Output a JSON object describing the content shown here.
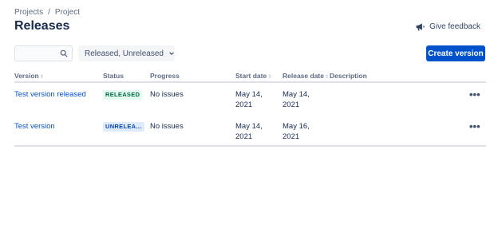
{
  "breadcrumb": [
    {
      "label": "Projects"
    },
    {
      "label": "/"
    },
    {
      "label": "Project"
    }
  ],
  "title": "Releases",
  "feedback": {
    "label": "Give feedback",
    "icon": "megaphone-icon"
  },
  "search": {
    "value": "",
    "placeholder": "",
    "icon": "search-icon"
  },
  "filter": {
    "label": "Released, Unreleased",
    "icon": "chevron-down-icon"
  },
  "create_button": {
    "label": "Create version"
  },
  "columns": [
    "Version",
    "Status",
    "Progress",
    "Start date",
    "Release date",
    "Description"
  ],
  "rows": [
    {
      "version": "Test version released",
      "status": "RELEASED",
      "progress": "No issues",
      "start_date": [
        "May 14,",
        "2021"
      ],
      "release_date": [
        "May 14,",
        "2021"
      ],
      "description": "",
      "more": "•••"
    },
    {
      "version": "Test version",
      "status": "UNRELEA...",
      "progress": "No issues",
      "start_date": [
        "May 14,",
        "2021"
      ],
      "release_date": [
        "May 16,",
        "2021"
      ],
      "description": "",
      "more": "•••"
    }
  ],
  "colors": {
    "primary": "#0052cc",
    "released_bg": "#e3fcef",
    "released_fg": "#006644",
    "unreleased_bg": "#deebff",
    "unreleased_fg": "#0747a6"
  }
}
